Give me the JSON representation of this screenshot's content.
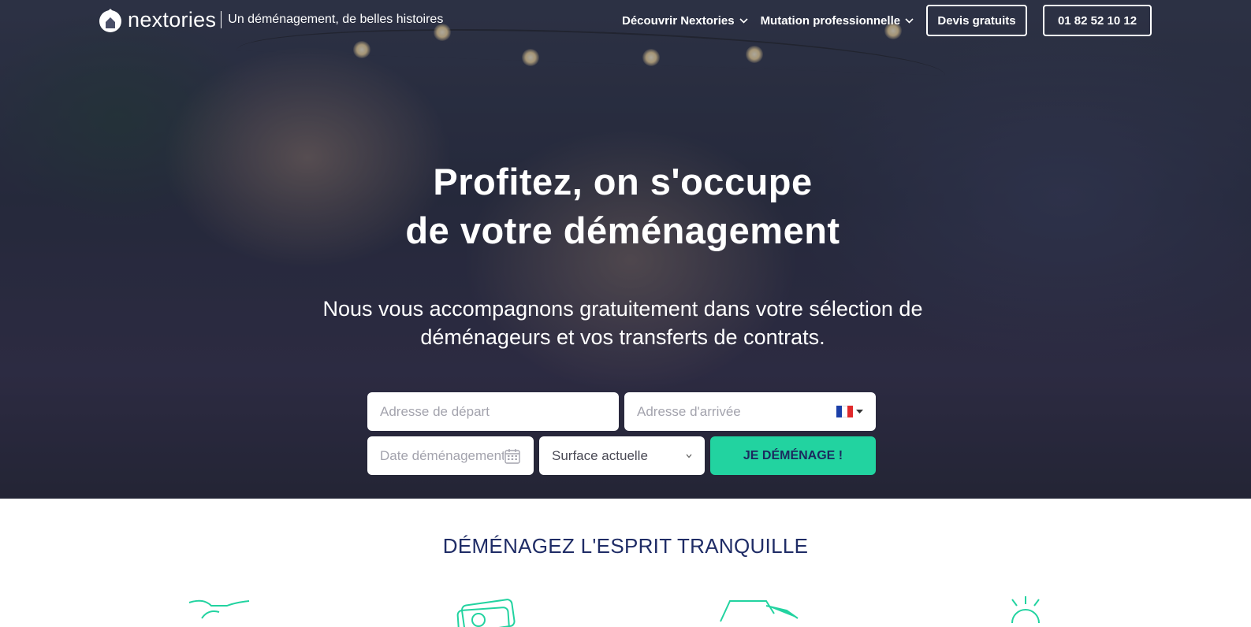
{
  "header": {
    "logo_name": "nextories",
    "tagline": "Un déménagement, de belles histoires",
    "nav": [
      {
        "label": "Découvrir Nextories",
        "icon": "chevron-down-icon"
      },
      {
        "label": "Mutation professionnelle",
        "icon": "chevron-down-icon"
      }
    ],
    "quote_button": "Devis gratuits",
    "phone_button": "01 82 52 10 12"
  },
  "hero": {
    "headline_line1": "Profitez, on s'occupe",
    "headline_line2": "de votre déménagement",
    "subline_line1": "Nous vous accompagnons gratuitement dans votre sélection de",
    "subline_line2": "déménageurs et vos transferts de contrats."
  },
  "form": {
    "departure_placeholder": "Adresse de départ",
    "arrival_placeholder": "Adresse d'arrivée",
    "country_flag": "flag-fr-icon",
    "date_placeholder": "Date déménagement",
    "surface_selected": "Surface actuelle",
    "submit_label": "JE DÉMÉNAGE !"
  },
  "section": {
    "title": "DÉMÉNAGEZ L'ESPRIT TRANQUILLE",
    "feature_icons": [
      "handshake-icon",
      "money-icon",
      "truck-icon",
      "sun-icon"
    ]
  },
  "colors": {
    "accent": "#22d3a0",
    "navy": "#1f2c66",
    "flag_blue": "#1b3fa8",
    "flag_red": "#e0292b"
  }
}
